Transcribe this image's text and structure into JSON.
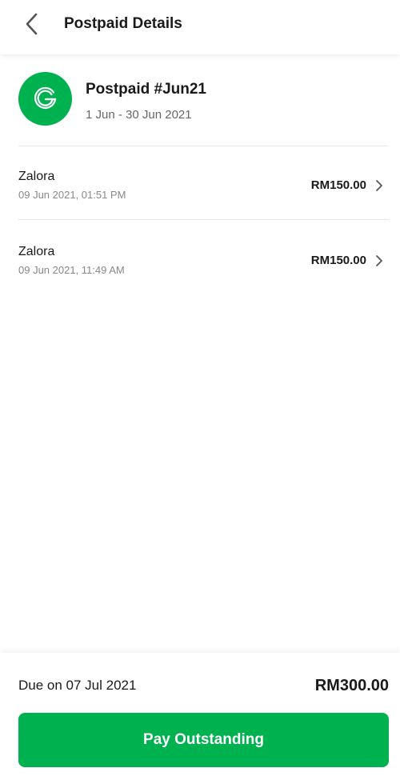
{
  "colors": {
    "brand_green": "#00B14F",
    "text_primary": "#1a1a1a",
    "text_secondary": "#666666",
    "text_muted": "#888888"
  },
  "header": {
    "back_icon": "chevron-left-icon",
    "title": "Postpaid Details"
  },
  "plan": {
    "logo_icon": "grab-g-logo",
    "name": "Postpaid #Jun21",
    "period": "1 Jun - 30 Jun 2021"
  },
  "transactions": [
    {
      "merchant": "Zalora",
      "datetime": "09 Jun 2021, 01:51 PM",
      "amount": "RM150.00",
      "chevron_icon": "chevron-right-icon"
    },
    {
      "merchant": "Zalora",
      "datetime": "09 Jun 2021, 11:49 AM",
      "amount": "RM150.00",
      "chevron_icon": "chevron-right-icon"
    }
  ],
  "footer": {
    "due_label": "Due on 07 Jul 2021",
    "due_amount": "RM300.00",
    "pay_button_label": "Pay Outstanding"
  }
}
